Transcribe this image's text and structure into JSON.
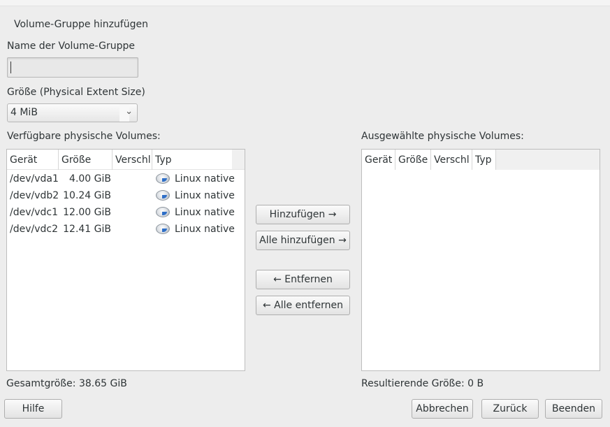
{
  "dialog": {
    "title": "Volume-Gruppe hinzufügen"
  },
  "name_field": {
    "label": "Name der Volume-Gruppe",
    "value": ""
  },
  "size_field": {
    "label": "Größe (Physical Extent Size)",
    "selected": "4 MiB"
  },
  "available": {
    "label": "Verfügbare physische Volumes:",
    "columns": [
      "Gerät",
      "Größe",
      "Verschl",
      "Typ"
    ],
    "rows": [
      {
        "device": "/dev/vda1",
        "size": "4.00 GiB",
        "encrypted": "",
        "type": "Linux native",
        "icon": "disk-icon"
      },
      {
        "device": "/dev/vdb2",
        "size": "10.24 GiB",
        "encrypted": "",
        "type": "Linux native",
        "icon": "disk-icon"
      },
      {
        "device": "/dev/vdc1",
        "size": "12.00 GiB",
        "encrypted": "",
        "type": "Linux native",
        "icon": "disk-icon"
      },
      {
        "device": "/dev/vdc2",
        "size": "12.41 GiB",
        "encrypted": "",
        "type": "Linux native",
        "icon": "disk-icon"
      }
    ],
    "total": "Gesamtgröße: 38.65 GiB"
  },
  "selected": {
    "label": "Ausgewählte physische Volumes:",
    "columns": [
      "Gerät",
      "Größe",
      "Verschl",
      "Typ"
    ],
    "total": "Resultierende Größe: 0 B"
  },
  "transfer_buttons": {
    "add": "Hinzufügen →",
    "add_all": "Alle hinzufügen →",
    "remove": "← Entfernen",
    "remove_all": "← Alle entfernen"
  },
  "footer": {
    "help": "Hilfe",
    "cancel": "Abbrechen",
    "back": "Zurück",
    "finish": "Beenden"
  }
}
